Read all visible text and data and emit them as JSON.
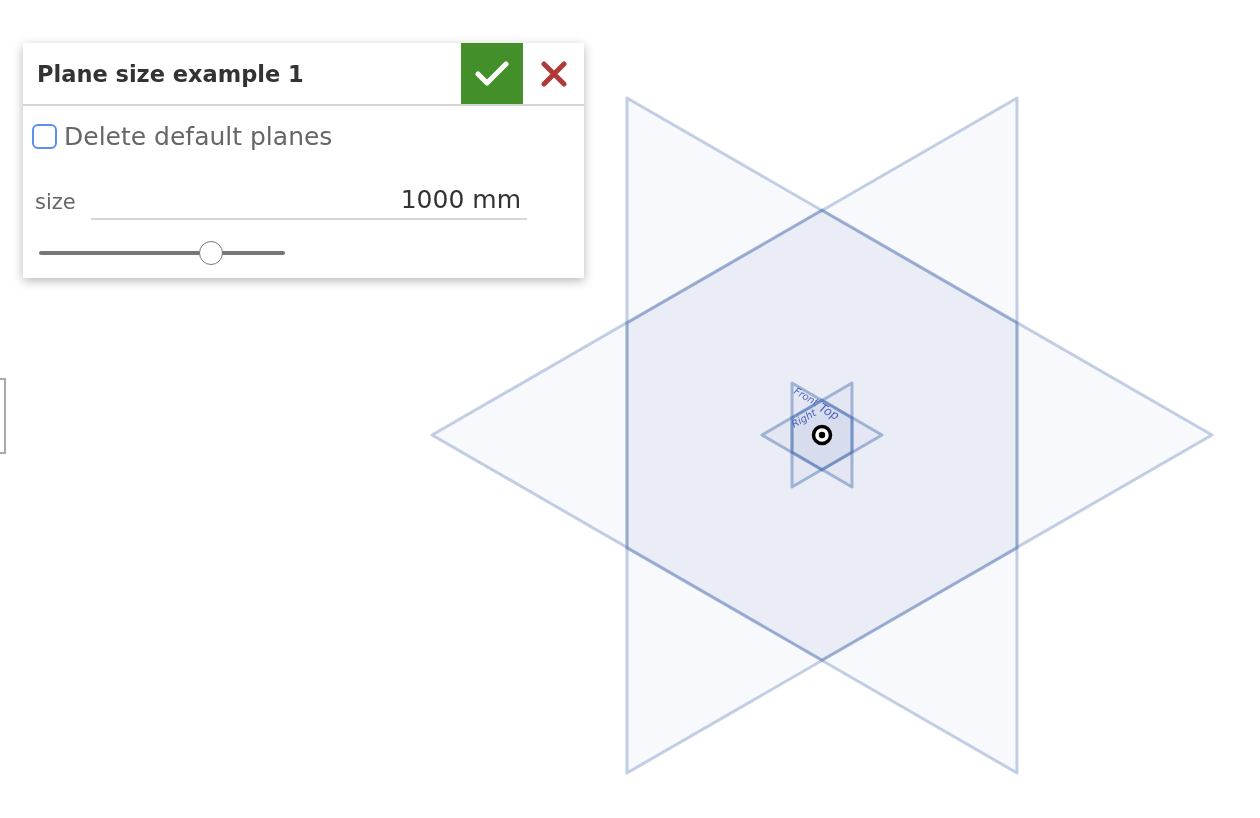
{
  "dialog": {
    "title": "Plane size example 1",
    "checkbox": {
      "label": "Delete default planes",
      "checked": false
    },
    "size_field": {
      "label": "size",
      "value": "1000 mm"
    },
    "slider": {
      "level": 0.7
    }
  },
  "viewport": {
    "plane_labels": [
      "Front",
      "Top",
      "Right"
    ]
  }
}
